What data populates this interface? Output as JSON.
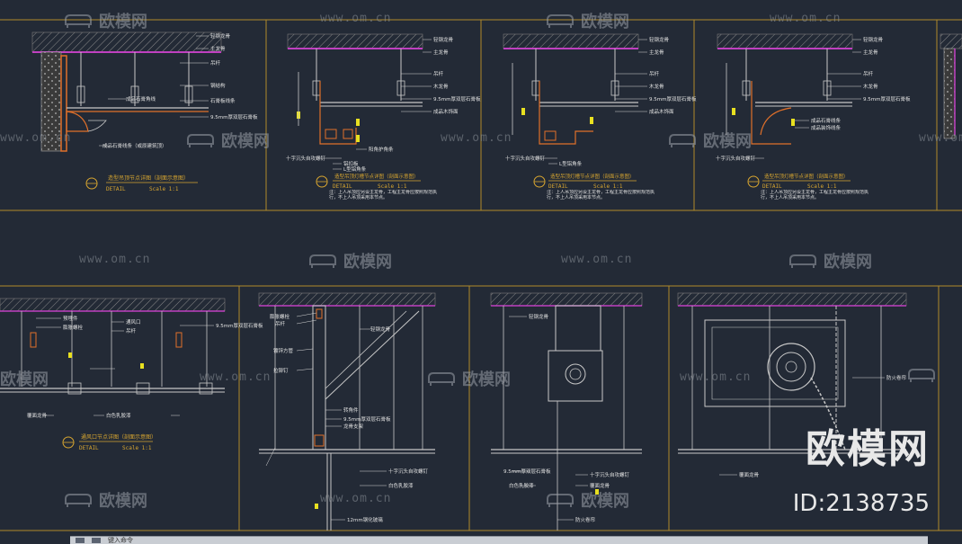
{
  "colors": {
    "background": "#232a36",
    "frame": "#b08a2a",
    "linework": "#c8c8c8",
    "leader": "#d6d6d6",
    "text": "#e0e0e0",
    "title_text": "#d8a630",
    "magenta": "#c040c0",
    "orange": "#e0702a",
    "yellow": "#e8e020",
    "hatch": "#7c7c7c"
  },
  "watermarks": {
    "website": "www.om.cn",
    "brand": "欧模网",
    "big_brand": "欧模网",
    "id_label": "ID:2138735"
  },
  "panels": {
    "p1": {
      "labels": [
        "轻钢龙骨",
        "主龙骨",
        "钢结构",
        "吊杆",
        "石膏板线条",
        "9.5mm厚双层石膏板",
        "成品石膏角线",
        "成品石膏线条（或原建筑顶）"
      ],
      "title": "造型吊顶节点详图（剖面示意图）",
      "detail": "DETAIL",
      "scale": "Scale 1:1"
    },
    "p2": {
      "labels": [
        "轻钢龙骨",
        "主龙骨",
        "吊杆",
        "9.5mm厚双层石膏板",
        "木龙骨",
        "成品木饰面",
        "阳角护角条",
        "十字沉头自攻螺钉",
        "9.5mm厚双层石膏板",
        "铝扣板",
        "L型铝角条",
        "石膏线"
      ],
      "title": "造型吊顶灯槽节点详图（剖面示意图）",
      "detail": "DETAIL",
      "scale": "Scale 1:1",
      "note": "注：上人吊顶应另设主龙骨，工程主龙骨应按照规范执行，不上人吊顶采用本节点。"
    },
    "p3": {
      "labels": [
        "轻钢龙骨",
        "主龙骨",
        "吊杆",
        "9.5mm厚双层石膏板",
        "木龙骨",
        "成品木饰面",
        "十字沉头自攻螺钉",
        "铝扣板",
        "L型铝角条",
        "石膏线"
      ],
      "title": "造型吊顶灯槽节点详图（剖面示意图）",
      "detail": "DETAIL",
      "scale": "Scale 1:1",
      "note": "注：上人吊顶应另设主龙骨，工程主龙骨应按照规范执行，不上人吊顶采用本节点。"
    },
    "p4": {
      "labels": [
        "轻钢龙骨",
        "主龙骨",
        "吊杆",
        "9.5mm厚双层石膏板",
        "木龙骨",
        "成品木饰面",
        "成品石膏线条",
        "成品装饰线条",
        "十字沉头自攻螺钉",
        "铝扣板"
      ],
      "title": "造型吊顶灯槽节点详图（剖面示意图）",
      "detail": "DETAIL",
      "scale": "Scale 1:1",
      "note": "注：上人吊顶应另设主龙骨，工程主龙骨应按照规范执行，不上人吊顶采用本节点。"
    },
    "p5": {
      "labels": [
        "预埋件",
        "膨胀螺栓",
        "通风口",
        "吊杆",
        "9.5mm厚双层石膏板",
        "覆面龙骨",
        "白色乳胶漆"
      ],
      "title": "通风口节点详图（剖面示意图）",
      "detail": "DETAIL",
      "scale": "Scale 1:1"
    },
    "p6": {
      "labels": [
        "轻钢龙骨",
        "膨胀螺栓",
        "吊杆",
        "镀锌方管",
        "拉铆钉",
        "转角件",
        "9.5mm厚双层石膏板",
        "龙骨支架",
        "白色乳胶漆",
        "十字沉头自攻螺钉",
        "12mm钢化玻璃"
      ]
    },
    "p7": {
      "labels": [
        "轻钢龙骨",
        "吊杆",
        "9.5mm厚双层石膏板",
        "十字沉头自攻螺钉",
        "覆面龙骨",
        "白色乳胶漆",
        "防火卷帘"
      ]
    },
    "p8": {
      "labels": [
        "轻钢龙骨",
        "吊杆",
        "防火卷帘",
        "覆面龙骨",
        "十字沉头自攻螺钉",
        "9.5mm厚双层石膏板"
      ]
    }
  },
  "statusbar": {
    "prompt": "键入命令"
  }
}
